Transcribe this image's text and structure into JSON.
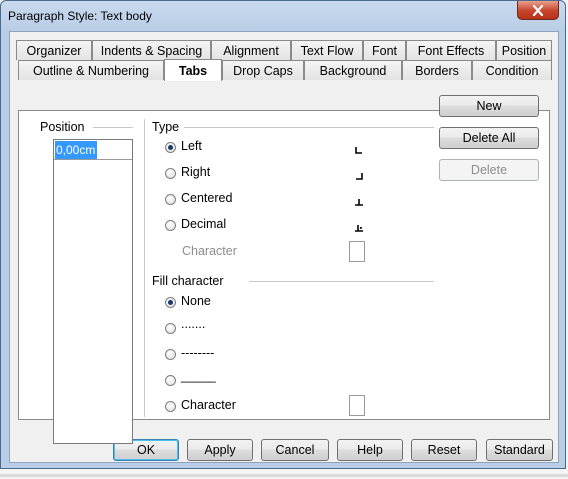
{
  "window": {
    "title": "Paragraph Style: Text body"
  },
  "tabs_row1": [
    "Organizer",
    "Indents & Spacing",
    "Alignment",
    "Text Flow",
    "Font",
    "Font Effects",
    "Position"
  ],
  "tabs_row2": [
    "Outline & Numbering",
    "Tabs",
    "Drop Caps",
    "Background",
    "Borders",
    "Condition"
  ],
  "active_tab": "Tabs",
  "position": {
    "label": "Position",
    "value": "0,00cm"
  },
  "type": {
    "label": "Type",
    "options": [
      {
        "label": "Left",
        "checked": true,
        "icon": "tab-left-icon"
      },
      {
        "label": "Right",
        "checked": false,
        "icon": "tab-right-icon"
      },
      {
        "label": "Centered",
        "checked": false,
        "icon": "tab-center-icon"
      },
      {
        "label": "Decimal",
        "checked": false,
        "icon": "tab-decimal-icon"
      }
    ],
    "character_label": "Character"
  },
  "fill": {
    "label": "Fill character",
    "options": [
      {
        "label": "None",
        "checked": true
      },
      {
        "label": ".......",
        "checked": false
      },
      {
        "label": "--------",
        "checked": false
      },
      {
        "label": "_____",
        "checked": false
      },
      {
        "label": "Character",
        "checked": false
      }
    ]
  },
  "side_buttons": {
    "new": "New",
    "delete_all": "Delete All",
    "delete": "Delete"
  },
  "bottom_buttons": {
    "ok": "OK",
    "apply": "Apply",
    "cancel": "Cancel",
    "help": "Help",
    "reset": "Reset",
    "standard": "Standard"
  },
  "colors": {
    "selection": "#3399ff",
    "frame": "#b9cde6",
    "close": "#c7432a"
  }
}
